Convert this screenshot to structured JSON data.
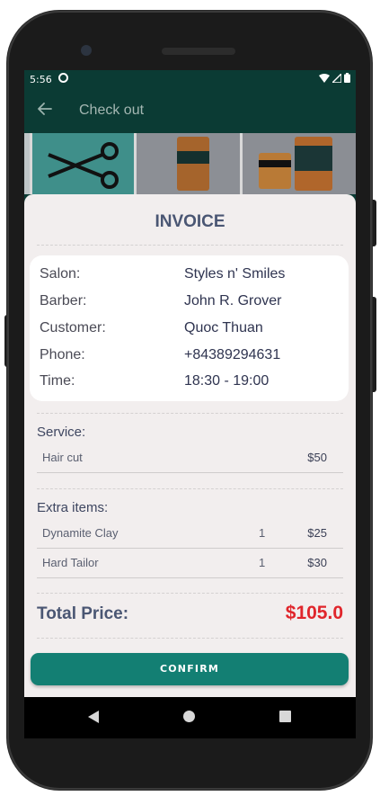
{
  "status_bar": {
    "time": "5:56"
  },
  "app_bar": {
    "title": "Check out"
  },
  "invoice": {
    "title": "INVOICE",
    "info": [
      {
        "label": "Salon:",
        "value": "Styles n' Smiles"
      },
      {
        "label": "Barber:",
        "value": "John R. Grover"
      },
      {
        "label": "Customer:",
        "value": "Quoc Thuan"
      },
      {
        "label": "Phone:",
        "value": "+84389294631"
      },
      {
        "label": "Time:",
        "value": "18:30 - 19:00"
      }
    ],
    "service_title": "Service:",
    "services": [
      {
        "name": "Hair cut",
        "price": "$50"
      }
    ],
    "extra_title": "Extra items:",
    "extras": [
      {
        "name": "Dynamite Clay",
        "qty": "1",
        "price": "$25"
      },
      {
        "name": "Hard Tailor",
        "qty": "1",
        "price": "$30"
      }
    ],
    "total_label": "Total Price:",
    "total_value": "$105.0"
  },
  "confirm_label": "CONFIRM",
  "colors": {
    "app_bar": "#0b3b34",
    "accent": "#137f73",
    "total": "#e0252b",
    "sheet": "#f2eeee"
  }
}
